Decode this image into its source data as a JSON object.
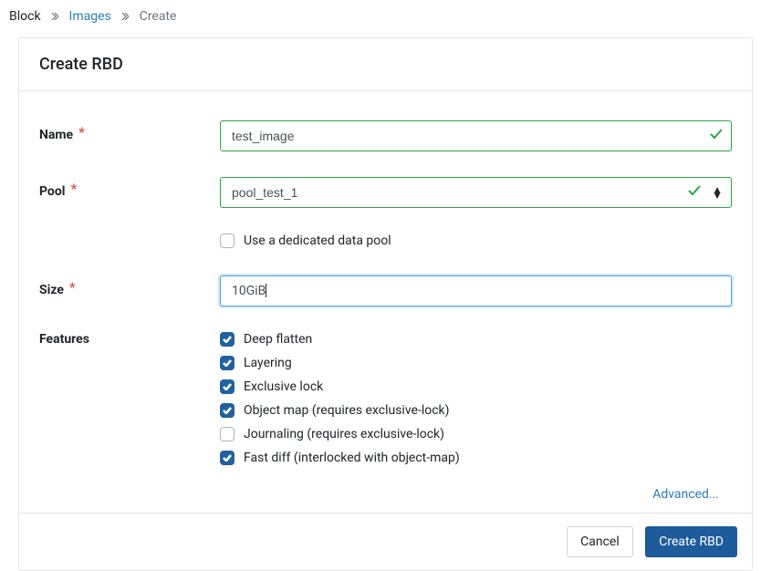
{
  "breadcrumb": [
    "Block",
    "Images",
    "Create"
  ],
  "card_title": "Create RBD",
  "labels": {
    "name": "Name",
    "pool": "Pool",
    "size": "Size",
    "features": "Features"
  },
  "fields": {
    "name_value": "test_image",
    "pool_value": "pool_test_1",
    "size_value": "10GiB",
    "dedicated_pool_label": "Use a dedicated data pool",
    "dedicated_pool_checked": false
  },
  "features": [
    {
      "label": "Deep flatten",
      "checked": true
    },
    {
      "label": "Layering",
      "checked": true
    },
    {
      "label": "Exclusive lock",
      "checked": true
    },
    {
      "label": "Object map (requires exclusive-lock)",
      "checked": true
    },
    {
      "label": "Journaling (requires exclusive-lock)",
      "checked": false
    },
    {
      "label": "Fast diff (interlocked with object-map)",
      "checked": true
    }
  ],
  "advanced_label": "Advanced...",
  "buttons": {
    "cancel": "Cancel",
    "submit": "Create RBD"
  }
}
